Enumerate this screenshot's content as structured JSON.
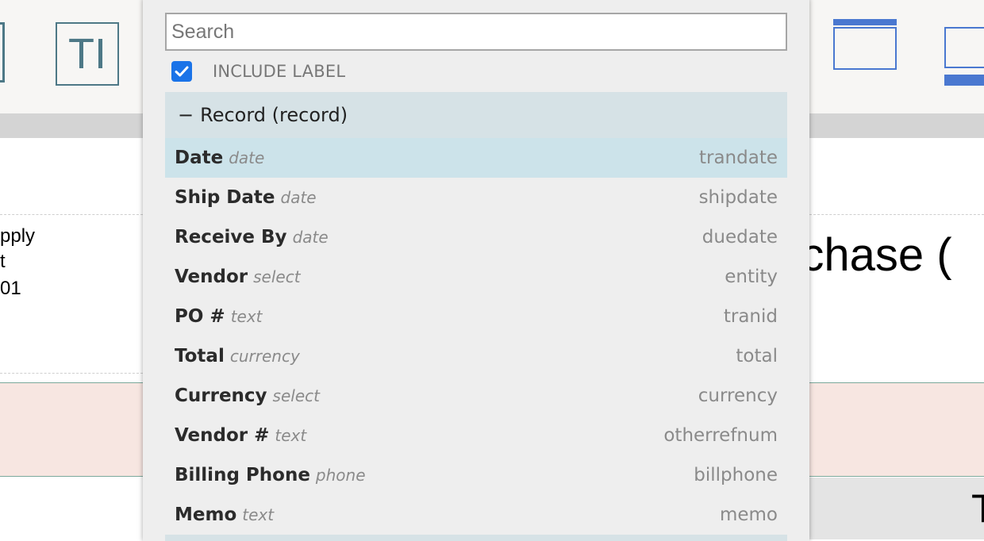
{
  "toolbar": {
    "text_tool_label": "TI"
  },
  "page_background": {
    "address_lines": [
      "pply",
      "t",
      "01"
    ],
    "title_fragment": "rchase (",
    "cell_fragment": "T"
  },
  "picker": {
    "search": {
      "placeholder": "Search",
      "value": ""
    },
    "include_label": {
      "text": "INCLUDE LABEL",
      "checked": true
    },
    "group": {
      "toggle": "−",
      "label": "Record (record)"
    },
    "fields": [
      {
        "label": "Date",
        "type": "date",
        "id": "trandate",
        "selected": true
      },
      {
        "label": "Ship Date",
        "type": "date",
        "id": "shipdate",
        "selected": false
      },
      {
        "label": "Receive By",
        "type": "date",
        "id": "duedate",
        "selected": false
      },
      {
        "label": "Vendor",
        "type": "select",
        "id": "entity",
        "selected": false
      },
      {
        "label": "PO #",
        "type": "text",
        "id": "tranid",
        "selected": false
      },
      {
        "label": "Total",
        "type": "currency",
        "id": "total",
        "selected": false
      },
      {
        "label": "Currency",
        "type": "select",
        "id": "currency",
        "selected": false
      },
      {
        "label": "Vendor #",
        "type": "text",
        "id": "otherrefnum",
        "selected": false
      },
      {
        "label": "Billing Phone",
        "type": "phone",
        "id": "billphone",
        "selected": false
      },
      {
        "label": "Memo",
        "type": "text",
        "id": "memo",
        "selected": false
      }
    ]
  },
  "colors": {
    "accent": "#1a73e8",
    "tool_icon": "#4d7886",
    "layout_icon": "#4a78d0",
    "selected_row": "#cce3ea",
    "group_header": "#d6e2e6"
  }
}
